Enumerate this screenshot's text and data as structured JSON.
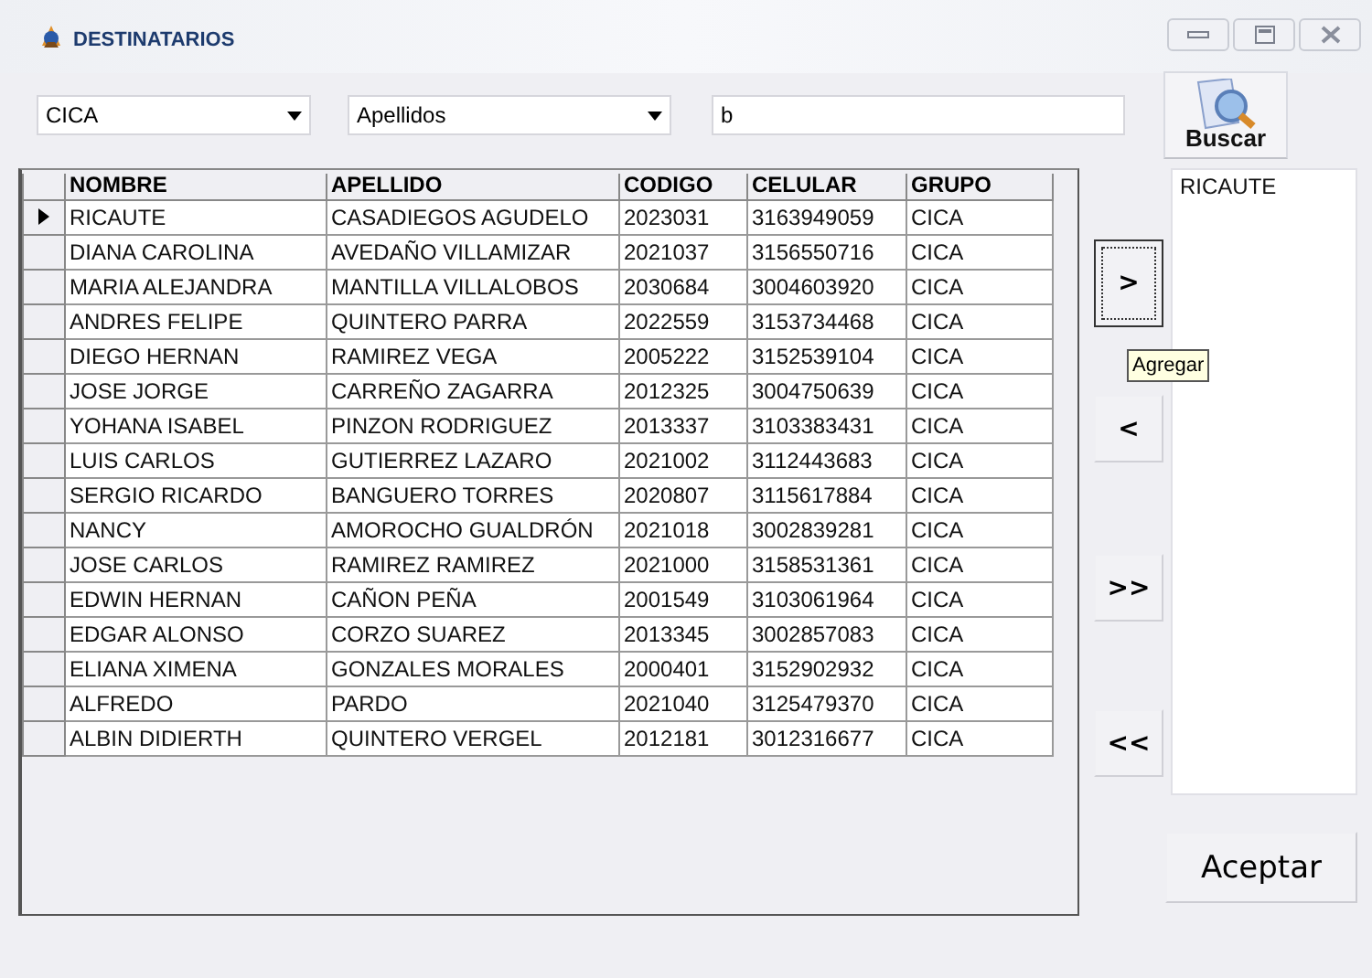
{
  "window": {
    "title": "DESTINATARIOS"
  },
  "filters": {
    "group": "CICA",
    "field": "Apellidos",
    "search": "b"
  },
  "search_button": "Buscar",
  "table": {
    "columns": [
      "NOMBRE",
      "APELLIDO",
      "CODIGO",
      "CELULAR",
      "GRUPO"
    ],
    "rows": [
      {
        "selected": true,
        "cells": [
          "RICAUTE",
          "CASADIEGOS AGUDELO",
          "2023031",
          "3163949059",
          "CICA"
        ]
      },
      {
        "selected": false,
        "cells": [
          "DIANA CAROLINA",
          "AVEDAÑO VILLAMIZAR",
          "2021037",
          "3156550716",
          "CICA"
        ]
      },
      {
        "selected": false,
        "cells": [
          "MARIA ALEJANDRA",
          "MANTILLA VILLALOBOS",
          "2030684",
          "3004603920",
          "CICA"
        ]
      },
      {
        "selected": false,
        "cells": [
          "ANDRES FELIPE",
          "QUINTERO PARRA",
          "2022559",
          "3153734468",
          "CICA"
        ]
      },
      {
        "selected": false,
        "cells": [
          "DIEGO HERNAN",
          "RAMIREZ VEGA",
          "2005222",
          "3152539104",
          "CICA"
        ]
      },
      {
        "selected": false,
        "cells": [
          "JOSE JORGE",
          "CARREÑO ZAGARRA",
          "2012325",
          "3004750639",
          "CICA"
        ]
      },
      {
        "selected": false,
        "cells": [
          "YOHANA ISABEL",
          "PINZON RODRIGUEZ",
          "2013337",
          "3103383431",
          "CICA"
        ]
      },
      {
        "selected": false,
        "cells": [
          "LUIS CARLOS",
          "GUTIERREZ LAZARO",
          "2021002",
          "3112443683",
          "CICA"
        ]
      },
      {
        "selected": false,
        "cells": [
          "SERGIO RICARDO",
          "BANGUERO TORRES",
          "2020807",
          "3115617884",
          "CICA"
        ]
      },
      {
        "selected": false,
        "cells": [
          "NANCY",
          "AMOROCHO GUALDRÓN",
          "2021018",
          "3002839281",
          "CICA"
        ]
      },
      {
        "selected": false,
        "cells": [
          "JOSE CARLOS",
          "RAMIREZ RAMIREZ",
          "2021000",
          "3158531361",
          "CICA"
        ]
      },
      {
        "selected": false,
        "cells": [
          "EDWIN HERNAN",
          "CAÑON PEÑA",
          "2001549",
          "3103061964",
          "CICA"
        ]
      },
      {
        "selected": false,
        "cells": [
          "EDGAR ALONSO",
          "CORZO SUAREZ",
          "2013345",
          "3002857083",
          "CICA"
        ]
      },
      {
        "selected": false,
        "cells": [
          "ELIANA XIMENA",
          "GONZALES MORALES",
          "2000401",
          "3152902932",
          "CICA"
        ]
      },
      {
        "selected": false,
        "cells": [
          "ALFREDO",
          "PARDO",
          "2021040",
          "3125479370",
          "CICA"
        ]
      },
      {
        "selected": false,
        "cells": [
          "ALBIN DIDIERTH",
          "QUINTERO VERGEL",
          "2012181",
          "3012316677",
          "CICA"
        ]
      }
    ]
  },
  "move_buttons": [
    {
      "label": ">",
      "focused": true
    },
    {
      "label": "<",
      "focused": false
    },
    {
      "label": ">>",
      "focused": false
    },
    {
      "label": "<<",
      "focused": false
    }
  ],
  "tooltip": "Agregar",
  "recipients": [
    "RICAUTE"
  ],
  "accept_button": "Aceptar"
}
